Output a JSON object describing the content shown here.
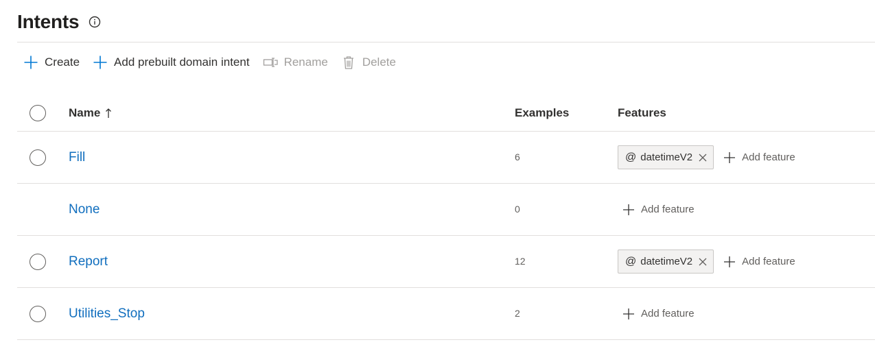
{
  "page": {
    "title": "Intents"
  },
  "toolbar": {
    "create_label": "Create",
    "add_prebuilt_label": "Add prebuilt domain intent",
    "rename_label": "Rename",
    "delete_label": "Delete"
  },
  "table": {
    "columns": {
      "name": "Name",
      "examples": "Examples",
      "features": "Features"
    },
    "sort": {
      "column": "Name",
      "direction": "ascending"
    },
    "rows": [
      {
        "name": "Fill",
        "examples": "6",
        "selectable": true,
        "features": [
          {
            "symbol": "@",
            "name": "datetimeV2"
          }
        ],
        "add_feature_label": "Add feature"
      },
      {
        "name": "None",
        "examples": "0",
        "selectable": false,
        "features": [],
        "add_feature_label": "Add feature"
      },
      {
        "name": "Report",
        "examples": "12",
        "selectable": true,
        "features": [
          {
            "symbol": "@",
            "name": "datetimeV2"
          }
        ],
        "add_feature_label": "Add feature"
      },
      {
        "name": "Utilities_Stop",
        "examples": "2",
        "selectable": true,
        "features": [],
        "add_feature_label": "Add feature"
      }
    ]
  },
  "icons": {
    "info": "info-icon",
    "add": "plus-icon",
    "rename": "rename-icon",
    "delete": "trash-icon",
    "sort": "arrow-up-icon",
    "remove": "close-icon"
  },
  "colors": {
    "accent": "#0078d4",
    "link": "#106ebe",
    "disabled": "#a19f9d",
    "chip_bg": "#f3f2f1"
  }
}
